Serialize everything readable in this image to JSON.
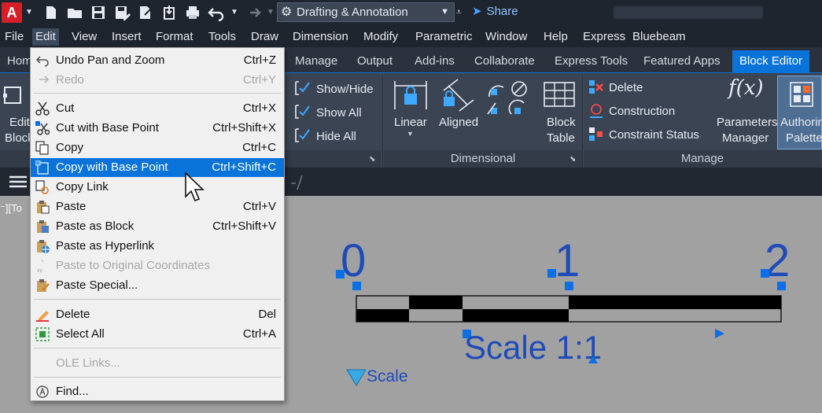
{
  "app": {
    "logo_letter": "A",
    "workspace": "Drafting & Annotation",
    "share_label": "Share"
  },
  "menubar": {
    "items": [
      "File",
      "Edit",
      "View",
      "Insert",
      "Format",
      "Tools",
      "Draw",
      "Dimension",
      "Modify",
      "Parametric",
      "Window",
      "Help",
      "Express",
      "Bluebeam"
    ]
  },
  "ribbon_tabs": {
    "items": [
      "Hom",
      "Manage",
      "Output",
      "Add-ins",
      "Collaborate",
      "Express Tools",
      "Featured Apps",
      "Block Editor"
    ],
    "active": "Block Editor"
  },
  "ribbon": {
    "edit_block": [
      "Edit",
      "Block"
    ],
    "show_hide": "Show/Hide",
    "show_all": "Show All",
    "hide_all": "Hide All",
    "linear": "Linear",
    "aligned": "Aligned",
    "dimensional_panel": "Dimensional",
    "block_table": [
      "Block",
      "Table"
    ],
    "delete": "Delete",
    "construction": "Construction",
    "constraint_status": "Constraint Status",
    "manage_panel": "Manage",
    "parameters_manager": [
      "Parameters",
      "Manager"
    ],
    "authoring_palettes": [
      "Authorin",
      "Palette"
    ],
    "fx_icon": "f(x)"
  },
  "viewport": {
    "label": "⁻][To"
  },
  "drawing": {
    "labels": [
      "0",
      "1",
      "2"
    ],
    "scale_text": "Scale 1:1",
    "scale_param": "Scale"
  },
  "edit_menu": {
    "items": [
      {
        "label": "Undo Pan and Zoom",
        "ul": "U",
        "rest": "ndo Pan and Zoom",
        "shortcut": "Ctrl+Z",
        "icon": "undo-icon",
        "disabled": false
      },
      {
        "label": "Redo",
        "ul": "",
        "rest": "Redo",
        "shortcut": "Ctrl+Y",
        "icon": "redo-icon",
        "disabled": true
      },
      {
        "label": "Cut",
        "ul": "t",
        "pre": "Cu",
        "shortcut": "Ctrl+X",
        "icon": "cut-icon",
        "disabled": false
      },
      {
        "label": "Cut with Base Point",
        "shortcut": "Ctrl+Shift+X",
        "icon": "cut-base-point-icon",
        "disabled": false
      },
      {
        "label": "Copy",
        "shortcut": "Ctrl+C",
        "icon": "copy-icon",
        "disabled": false
      },
      {
        "label": "Copy with Base Point",
        "shortcut": "Ctrl+Shift+C",
        "icon": "copy-base-point-icon",
        "disabled": false,
        "selected": true
      },
      {
        "label": "Copy Link",
        "shortcut": "",
        "icon": "copy-link-icon",
        "disabled": false
      },
      {
        "label": "Paste",
        "shortcut": "Ctrl+V",
        "icon": "paste-icon",
        "disabled": false
      },
      {
        "label": "Paste as Block",
        "shortcut": "Ctrl+Shift+V",
        "icon": "paste-block-icon",
        "disabled": false
      },
      {
        "label": "Paste as Hyperlink",
        "shortcut": "",
        "icon": "paste-hyperlink-icon",
        "disabled": false
      },
      {
        "label": "Paste to Original Coordinates",
        "shortcut": "",
        "icon": "paste-original-coordinates-icon",
        "disabled": true
      },
      {
        "label": "Paste Special...",
        "shortcut": "",
        "icon": "paste-special-icon",
        "disabled": false
      },
      {
        "label": "Delete",
        "shortcut": "Del",
        "icon": "eraser-icon",
        "disabled": false
      },
      {
        "label": "Select All",
        "shortcut": "Ctrl+A",
        "icon": "select-all-icon",
        "disabled": false
      },
      {
        "label": "OLE Links...",
        "shortcut": "",
        "icon": "",
        "disabled": true
      },
      {
        "label": "Find...",
        "shortcut": "",
        "icon": "find-icon",
        "disabled": false
      }
    ]
  },
  "colors": {
    "accent": "#0a73d9",
    "canvas": "#a1a1a1",
    "drawing_blue": "#1f4bb8",
    "grip_blue": "#0b6fe6"
  }
}
